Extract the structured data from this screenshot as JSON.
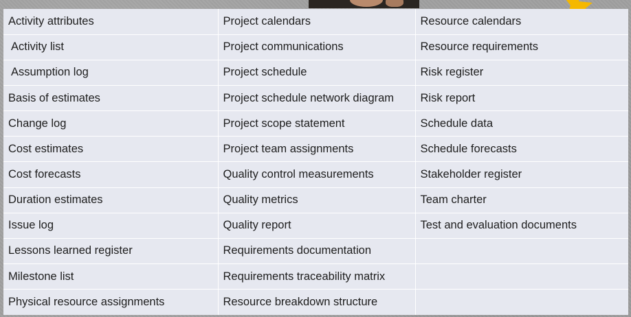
{
  "table": {
    "columns": [
      [
        "Activity attributes",
        "Activity list",
        "Assumption log",
        "Basis of estimates",
        "Change log",
        "Cost estimates",
        "Cost forecasts",
        "Duration estimates",
        "Issue log",
        "Lessons learned register",
        "Milestone list",
        "Physical resource assignments"
      ],
      [
        "Project calendars",
        "Project communications",
        "Project schedule",
        "Project schedule network diagram",
        "Project scope statement",
        "Project team assignments",
        "Quality control measurements",
        "Quality metrics",
        "Quality report",
        "Requirements documentation",
        "Requirements traceability matrix",
        "Resource breakdown structure"
      ],
      [
        "Resource calendars",
        "Resource requirements",
        "Risk register",
        "Risk report",
        "Schedule data",
        "Schedule forecasts",
        "Stakeholder register",
        "Team charter",
        "Test and evaluation documents",
        "",
        "",
        ""
      ]
    ]
  },
  "colors": {
    "cell_background": "#e6e8f0",
    "grid_line": "#ffffff",
    "text": "#1d1d1d",
    "badge": "#f5b800"
  },
  "icons": {
    "corner_badge": "yellow-star-badge-icon"
  }
}
